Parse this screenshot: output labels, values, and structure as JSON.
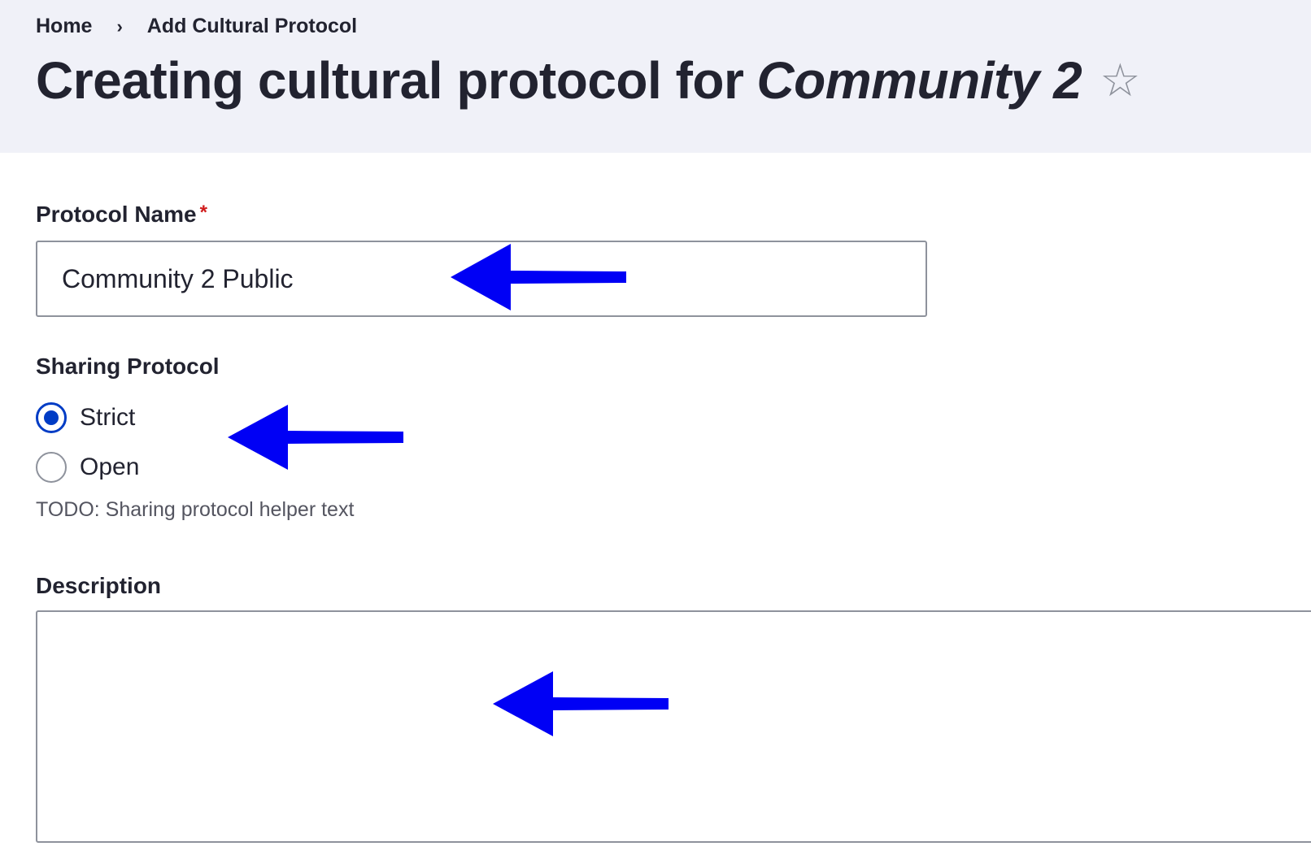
{
  "breadcrumb": {
    "home": "Home",
    "separator": "›",
    "current": "Add Cultural Protocol"
  },
  "page": {
    "title_prefix": "Creating cultural protocol for",
    "title_community": "Community 2",
    "favorite_icon": "☆"
  },
  "form": {
    "protocol_name": {
      "label": "Protocol Name",
      "required_marker": "*",
      "value": "Community 2 Public"
    },
    "sharing_protocol": {
      "label": "Sharing Protocol",
      "options": [
        {
          "label": "Strict",
          "checked": true
        },
        {
          "label": "Open",
          "checked": false
        }
      ],
      "helper_text": "TODO: Sharing protocol helper text"
    },
    "description": {
      "label": "Description",
      "value": ""
    }
  },
  "colors": {
    "header_bg": "#f0f1f8",
    "accent": "#003cc5",
    "annotation_arrow": "#0000f5",
    "required": "#d01a1a"
  }
}
